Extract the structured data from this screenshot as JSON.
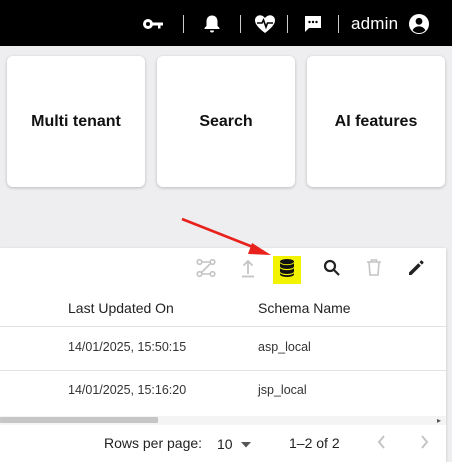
{
  "topbar": {
    "username": "admin",
    "icons": [
      "key-icon",
      "bell-icon",
      "heart-pulse-icon",
      "chat-icon",
      "account-circle-icon"
    ]
  },
  "cards": [
    {
      "label": "Multi tenant"
    },
    {
      "label": "Search"
    },
    {
      "label": "AI features"
    }
  ],
  "toolbar": {
    "buttons": [
      "lineage-icon",
      "upload-icon",
      "database-icon",
      "search-icon",
      "delete-icon",
      "edit-icon"
    ],
    "highlight_color": "#f3f300",
    "annotation_color": "#e8211c"
  },
  "table": {
    "columns": [
      "Last Updated On",
      "Schema Name"
    ],
    "rows": [
      {
        "updated": "14/01/2025, 15:50:15",
        "schema": "asp_local"
      },
      {
        "updated": "14/01/2025, 15:16:20",
        "schema": "jsp_local"
      }
    ]
  },
  "pagination": {
    "rows_per_page_label": "Rows per page:",
    "rows_per_page_value": "10",
    "range": "1–2 of 2"
  }
}
